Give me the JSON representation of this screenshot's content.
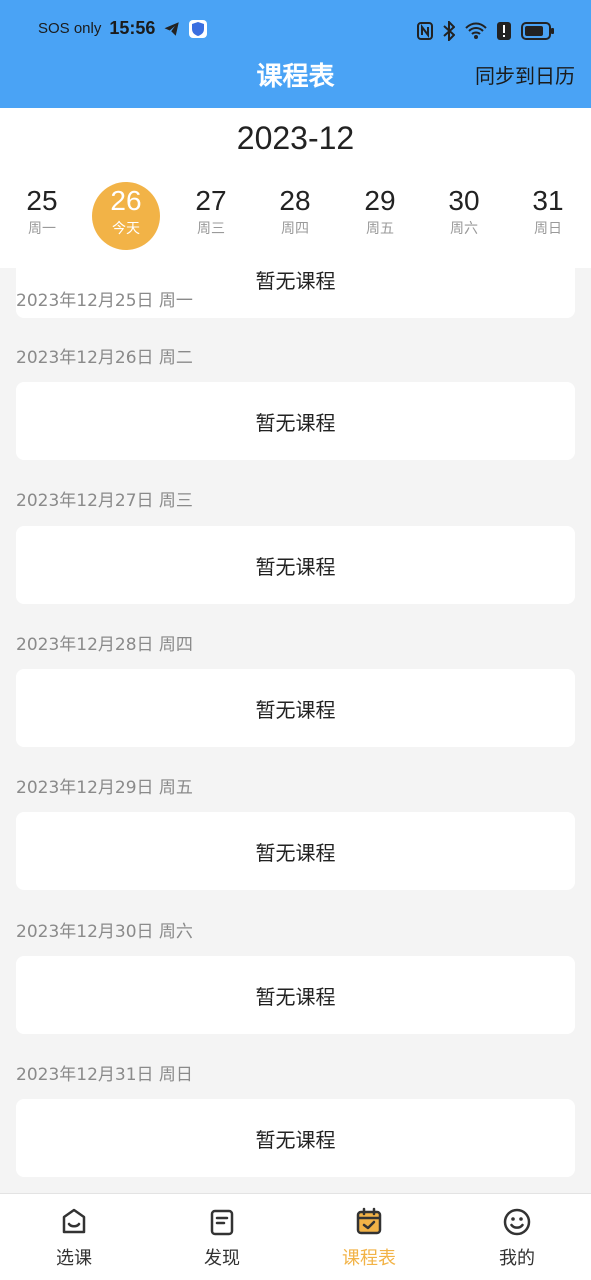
{
  "status_bar": {
    "carrier": "SOS only",
    "time": "15:56",
    "icons": [
      "telegram-icon",
      "shield-icon",
      "nfc-icon",
      "bluetooth-icon",
      "wifi-icon",
      "alert-icon",
      "battery-icon"
    ]
  },
  "header": {
    "title": "课程表",
    "sync_label": "同步到日历",
    "background": "#4aa3f5"
  },
  "calendar": {
    "month": "2023-12",
    "days": [
      {
        "num": "25",
        "label": "周一",
        "active": false
      },
      {
        "num": "26",
        "label": "今天",
        "active": true
      },
      {
        "num": "27",
        "label": "周三",
        "active": false
      },
      {
        "num": "28",
        "label": "周四",
        "active": false
      },
      {
        "num": "29",
        "label": "周五",
        "active": false
      },
      {
        "num": "30",
        "label": "周六",
        "active": false
      },
      {
        "num": "31",
        "label": "周日",
        "active": false
      }
    ],
    "accent": "#f2b347"
  },
  "schedule": [
    {
      "date": "2023年12月25日 周一",
      "text": "暂无课程"
    },
    {
      "date": "2023年12月26日 周二",
      "text": "暂无课程"
    },
    {
      "date": "2023年12月27日 周三",
      "text": "暂无课程"
    },
    {
      "date": "2023年12月28日 周四",
      "text": "暂无课程"
    },
    {
      "date": "2023年12月29日 周五",
      "text": "暂无课程"
    },
    {
      "date": "2023年12月30日 周六",
      "text": "暂无课程"
    },
    {
      "date": "2023年12月31日 周日",
      "text": "暂无课程"
    }
  ],
  "bottom_nav": [
    {
      "label": "选课",
      "icon": "course-select-icon",
      "active": false
    },
    {
      "label": "发现",
      "icon": "discover-icon",
      "active": false
    },
    {
      "label": "课程表",
      "icon": "calendar-check-icon",
      "active": true
    },
    {
      "label": "我的",
      "icon": "smile-icon",
      "active": false
    }
  ]
}
